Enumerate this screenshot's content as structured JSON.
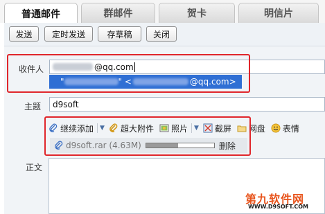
{
  "tabs": [
    {
      "label": "普通邮件",
      "active": true
    },
    {
      "label": "群邮件",
      "active": false
    },
    {
      "label": "贺卡",
      "active": false
    },
    {
      "label": "明信片",
      "active": false
    }
  ],
  "toolbar": {
    "send_label": "发送",
    "timed_send_label": "定时发送",
    "save_draft_label": "存草稿",
    "close_label": "关闭"
  },
  "form": {
    "recipient_label": "收件人",
    "recipient_value_suffix": "@qq.com",
    "suggestion": {
      "open_quote": "\"",
      "mid": "\" <",
      "suffix": "@qq.com>"
    },
    "subject_label": "主题",
    "subject_value": "d9soft",
    "body_label": "正文"
  },
  "attach_toolbar": {
    "continue_add_label": "继续添加",
    "large_attachment_label": "超大附件",
    "photo_label": "照片",
    "screenshot_label": "截屏",
    "netdisk_label": "网盘",
    "emoji_label": "表情"
  },
  "attachment": {
    "file_label": "d9soft.rar (4.63M)",
    "progress": 0.47,
    "delete_label": "删除"
  },
  "watermark": {
    "line1": "第九软件网",
    "line2": "WWW.D9SOFT.COM"
  },
  "colors": {
    "highlight_box": "#e0262b",
    "suggestion_bg": "#2f6fd4",
    "watermark": "#e8541c"
  },
  "icons": [
    "paperclip-icon",
    "large-attachment-icon",
    "photo-icon",
    "screenshot-icon",
    "netdisk-icon",
    "emoji-icon",
    "dropdown-arrow-icon"
  ]
}
